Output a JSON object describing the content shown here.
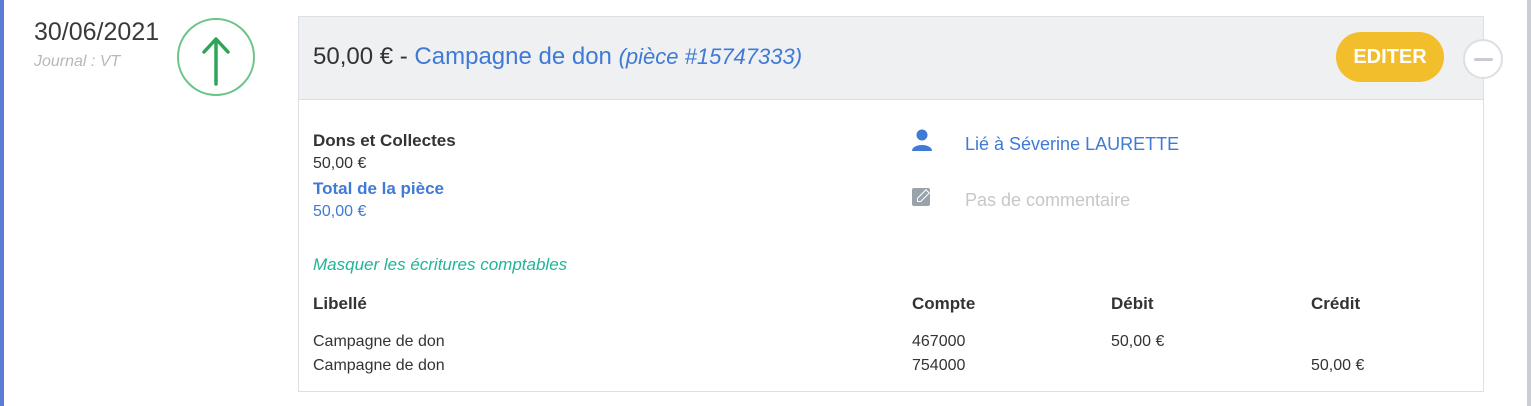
{
  "entry": {
    "date": "30/06/2021",
    "journal": "Journal : VT",
    "direction_icon": "arrow-up-icon",
    "colors": {
      "accent_blue": "#3f7ad6",
      "edit_yellow": "#f3be2c",
      "teal": "#1fb597",
      "arrow_green": "#2fa55a"
    }
  },
  "header": {
    "amount": "50,00 €",
    "separator": "-",
    "title": "Campagne de don",
    "piece": "(pièce #15747333)",
    "edit_label": "EDITER",
    "collapse_icon": "minus-circle-icon"
  },
  "summary": {
    "category_label": "Dons et Collectes",
    "category_value": "50,00 €",
    "total_label": "Total de la pièce",
    "total_value": "50,00 €"
  },
  "side": {
    "user_icon": "user-icon",
    "linked_user": "Lié à Séverine LAURETTE",
    "comment_icon": "edit-comment-icon",
    "no_comment": "Pas de commentaire"
  },
  "entries": {
    "toggle_label": "Masquer les écritures comptables",
    "headers": {
      "libelle": "Libellé",
      "compte": "Compte",
      "debit": "Débit",
      "credit": "Crédit"
    },
    "rows": [
      {
        "libelle": "Campagne de don",
        "compte": "467000",
        "debit": "50,00 €",
        "credit": ""
      },
      {
        "libelle": "Campagne de don",
        "compte": "754000",
        "debit": "",
        "credit": "50,00 €"
      }
    ]
  }
}
